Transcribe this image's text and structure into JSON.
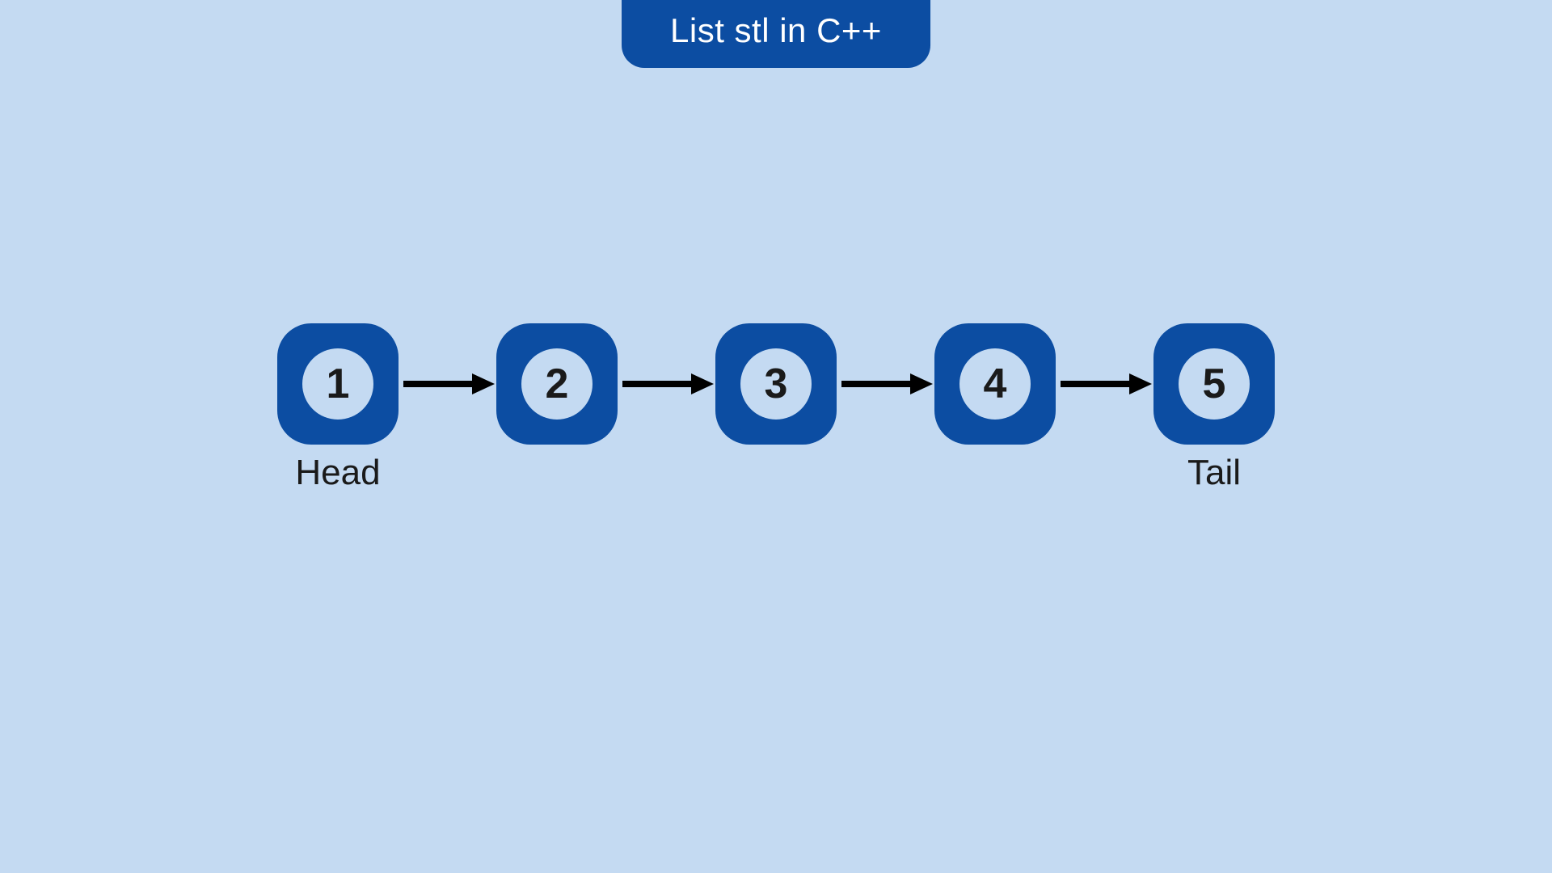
{
  "title": "List stl in C++",
  "colors": {
    "background": "#c4daf2",
    "accent": "#0c4da2",
    "text": "#1a1a1a",
    "arrow": "#000000"
  },
  "nodes": [
    {
      "value": "1",
      "label": "Head"
    },
    {
      "value": "2",
      "label": ""
    },
    {
      "value": "3",
      "label": ""
    },
    {
      "value": "4",
      "label": ""
    },
    {
      "value": "5",
      "label": "Tail"
    }
  ]
}
